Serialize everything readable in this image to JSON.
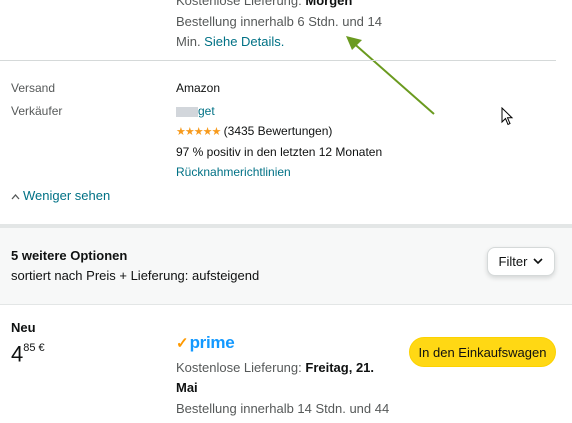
{
  "delivery_top": {
    "label_prefix": "Kostenlose Lieferung: ",
    "label_day": "Morgen",
    "order_line1": "Bestellung innerhalb 6 Stdn. und 14",
    "order_line2_prefix": "Min. ",
    "details_link": "Siehe Details."
  },
  "seller_info": {
    "shipping_label": "Versand",
    "shipping_value": "Amazon",
    "seller_label": "Verkäufer",
    "seller_name": "get",
    "rating_stars": "★★★★★",
    "rating_count": "(3435 Bewertungen)",
    "positive": "97 % positiv in den letzten 12 Monaten",
    "returns_link": "Rücknahmerichtlinien",
    "less_link": "Weniger sehen"
  },
  "options": {
    "title": "5 weitere Optionen",
    "subtitle": "sortiert nach Preis + Lieferung: aufsteigend",
    "filter_label": "Filter"
  },
  "offer": {
    "condition": "Neu",
    "price_whole": "4",
    "price_fraction": "85 €",
    "prime_label": "prime",
    "delivery_prefix": "Kostenlose Lieferung: ",
    "delivery_day_line1": "Freitag, 21.",
    "delivery_day_line2": "Mai",
    "order_line": "Bestellung innerhalb 14 Stdn. und 44",
    "cart_button": "In den Einkaufswagen"
  },
  "colors": {
    "link": "#007185",
    "cart_button": "#ffd814",
    "arrow": "#6a9a1f",
    "prime": "#1399ff"
  }
}
